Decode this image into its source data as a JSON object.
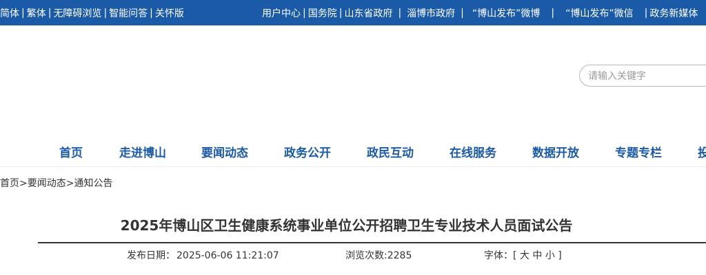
{
  "topbar": {
    "left": [
      "简体",
      "繁体",
      "无障碍浏览",
      "智能问答",
      "关怀版"
    ],
    "right": [
      "用户中心",
      "国务院",
      "山东省政府",
      "淄博市政府",
      "“博山发布”微博",
      "“博山发布”微信",
      "政务新媒体"
    ]
  },
  "search": {
    "placeholder": "请输入关键字"
  },
  "nav": [
    "首页",
    "走进博山",
    "要闻动态",
    "政务公开",
    "政民互动",
    "在线服务",
    "数据开放",
    "专题专栏",
    "投"
  ],
  "breadcrumb": {
    "items": [
      "首页",
      "要闻动态",
      "通知公告"
    ],
    "sep": ">"
  },
  "article": {
    "title": "2025年博山区卫生健康系统事业单位公开招聘卫生专业技术人员面试公告",
    "date_label": "发布日期：",
    "date_value": "2025-06-06 11:21:07",
    "views_label": "浏览次数:",
    "views_value": "2285",
    "font_label": "字体：[",
    "font_large": "大",
    "font_medium": "中",
    "font_small": "小",
    "font_close": "]"
  },
  "colors": {
    "topbar_bg": "#1b5aa6",
    "nav_text": "#1b5aa6"
  }
}
